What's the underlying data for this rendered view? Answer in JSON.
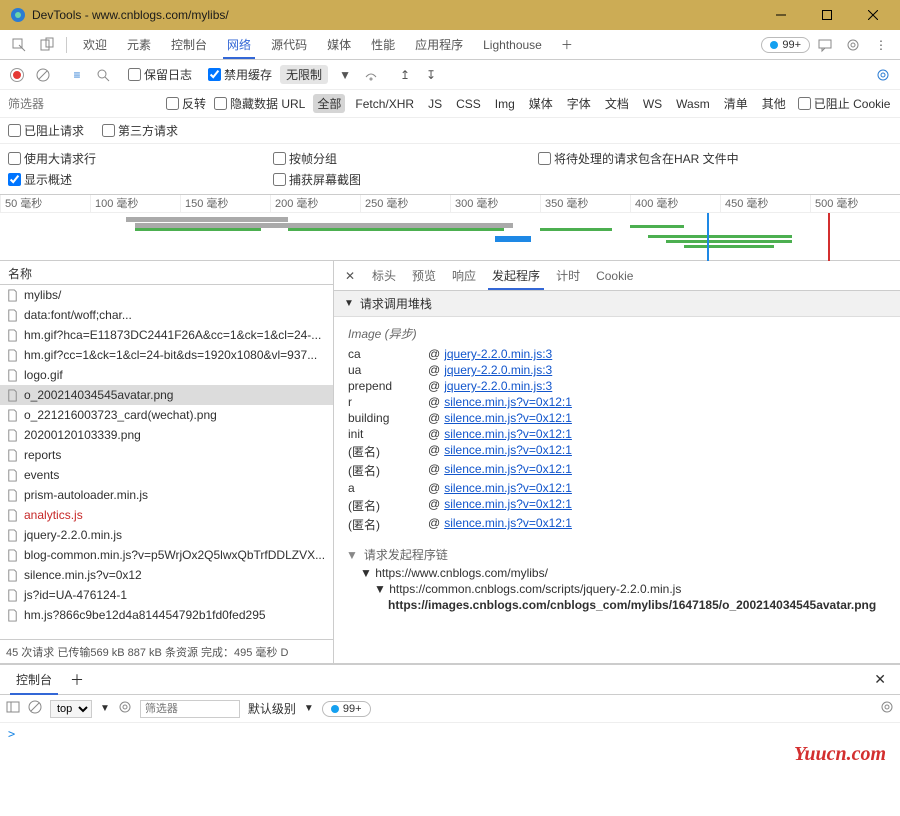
{
  "window": {
    "title": "DevTools - www.cnblogs.com/mylibs/"
  },
  "tabs": {
    "items": [
      "欢迎",
      "元素",
      "控制台",
      "网络",
      "源代码",
      "媒体",
      "性能",
      "应用程序",
      "Lighthouse"
    ],
    "active": 3,
    "overflow_badge": "99+"
  },
  "toolbar": {
    "preserve_log": "保留日志",
    "disable_cache": "禁用缓存",
    "throttle": "无限制"
  },
  "filter": {
    "placeholder": "筛选器",
    "invert": "反转",
    "hide_data_urls": "隐藏数据 URL",
    "types": [
      "全部",
      "Fetch/XHR",
      "JS",
      "CSS",
      "Img",
      "媒体",
      "字体",
      "文档",
      "WS",
      "Wasm",
      "清单",
      "其他"
    ],
    "blocked_cookie": "已阻止 Cookie",
    "blocked_requests": "已阻止请求",
    "third_party": "第三方请求"
  },
  "opts": {
    "large_rows": "使用大请求行",
    "group_frame": "按帧分组",
    "include_har": "将待处理的请求包含在HAR 文件中",
    "overview": "显示概述",
    "screenshots": "捕获屏幕截图"
  },
  "timeline_ticks": [
    "50 毫秒",
    "100 毫秒",
    "150 毫秒",
    "200 毫秒",
    "250 毫秒",
    "300 毫秒",
    "350 毫秒",
    "400 毫秒",
    "450 毫秒",
    "500 毫秒"
  ],
  "names": {
    "header": "名称",
    "rows": [
      {
        "t": "mylibs/"
      },
      {
        "t": "data:font/woff;char..."
      },
      {
        "t": "hm.gif?hca=E11873DC2441F26A&cc=1&ck=1&cl=24-..."
      },
      {
        "t": "hm.gif?cc=1&ck=1&cl=24-bit&ds=1920x1080&vl=937..."
      },
      {
        "t": "logo.gif"
      },
      {
        "t": "o_200214034545avatar.png",
        "sel": true
      },
      {
        "t": "o_221216003723_card(wechat).png"
      },
      {
        "t": "20200120103339.png"
      },
      {
        "t": "reports"
      },
      {
        "t": "events"
      },
      {
        "t": "prism-autoloader.min.js"
      },
      {
        "t": "analytics.js",
        "red": true
      },
      {
        "t": "jquery-2.2.0.min.js"
      },
      {
        "t": "blog-common.min.js?v=p5WrjOx2Q5lwxQbTrfDDLZVX..."
      },
      {
        "t": "silence.min.js?v=0x12"
      },
      {
        "t": "js?id=UA-476124-1"
      },
      {
        "t": "hm.js?866c9be12d4a814454792b1fd0fed295"
      }
    ],
    "footer": "45 次请求  已传输569 kB  887 kB 条资源  完成：495 毫秒  D"
  },
  "detail": {
    "tabs": [
      "标头",
      "预览",
      "响应",
      "发起程序",
      "计时",
      "Cookie"
    ],
    "active": 3,
    "section1": "请求调用堆栈",
    "async": "Image (异步)",
    "stack": [
      {
        "fn": "ca",
        "link": "jquery-2.2.0.min.js:3"
      },
      {
        "fn": "ua",
        "link": "jquery-2.2.0.min.js:3"
      },
      {
        "fn": "prepend",
        "link": "jquery-2.2.0.min.js:3"
      },
      {
        "fn": "r",
        "link": "silence.min.js?v=0x12:1"
      },
      {
        "fn": "building",
        "link": "silence.min.js?v=0x12:1"
      },
      {
        "fn": "init",
        "link": "silence.min.js?v=0x12:1"
      },
      {
        "fn": "(匿名)",
        "link": "silence.min.js?v=0x12:1"
      },
      {
        "fn": "(匿名)",
        "link": "silence.min.js?v=0x12:1"
      },
      {
        "fn": "a",
        "link": "silence.min.js?v=0x12:1"
      },
      {
        "fn": "(匿名)",
        "link": "silence.min.js?v=0x12:1"
      },
      {
        "fn": "(匿名)",
        "link": "silence.min.js?v=0x12:1"
      }
    ],
    "section2": "请求发起程序链",
    "chain": [
      "https://www.cnblogs.com/mylibs/",
      "https://common.cnblogs.com/scripts/jquery-2.2.0.min.js",
      "https://images.cnblogs.com/cnblogs_com/mylibs/1647185/o_200214034545avatar.png"
    ]
  },
  "drawer": {
    "tab": "控制台",
    "scope": "top",
    "filter_ph": "筛选器",
    "level": "默认级别",
    "badge": "99+",
    "prompt": ">"
  },
  "watermark": "Yuucn.com"
}
